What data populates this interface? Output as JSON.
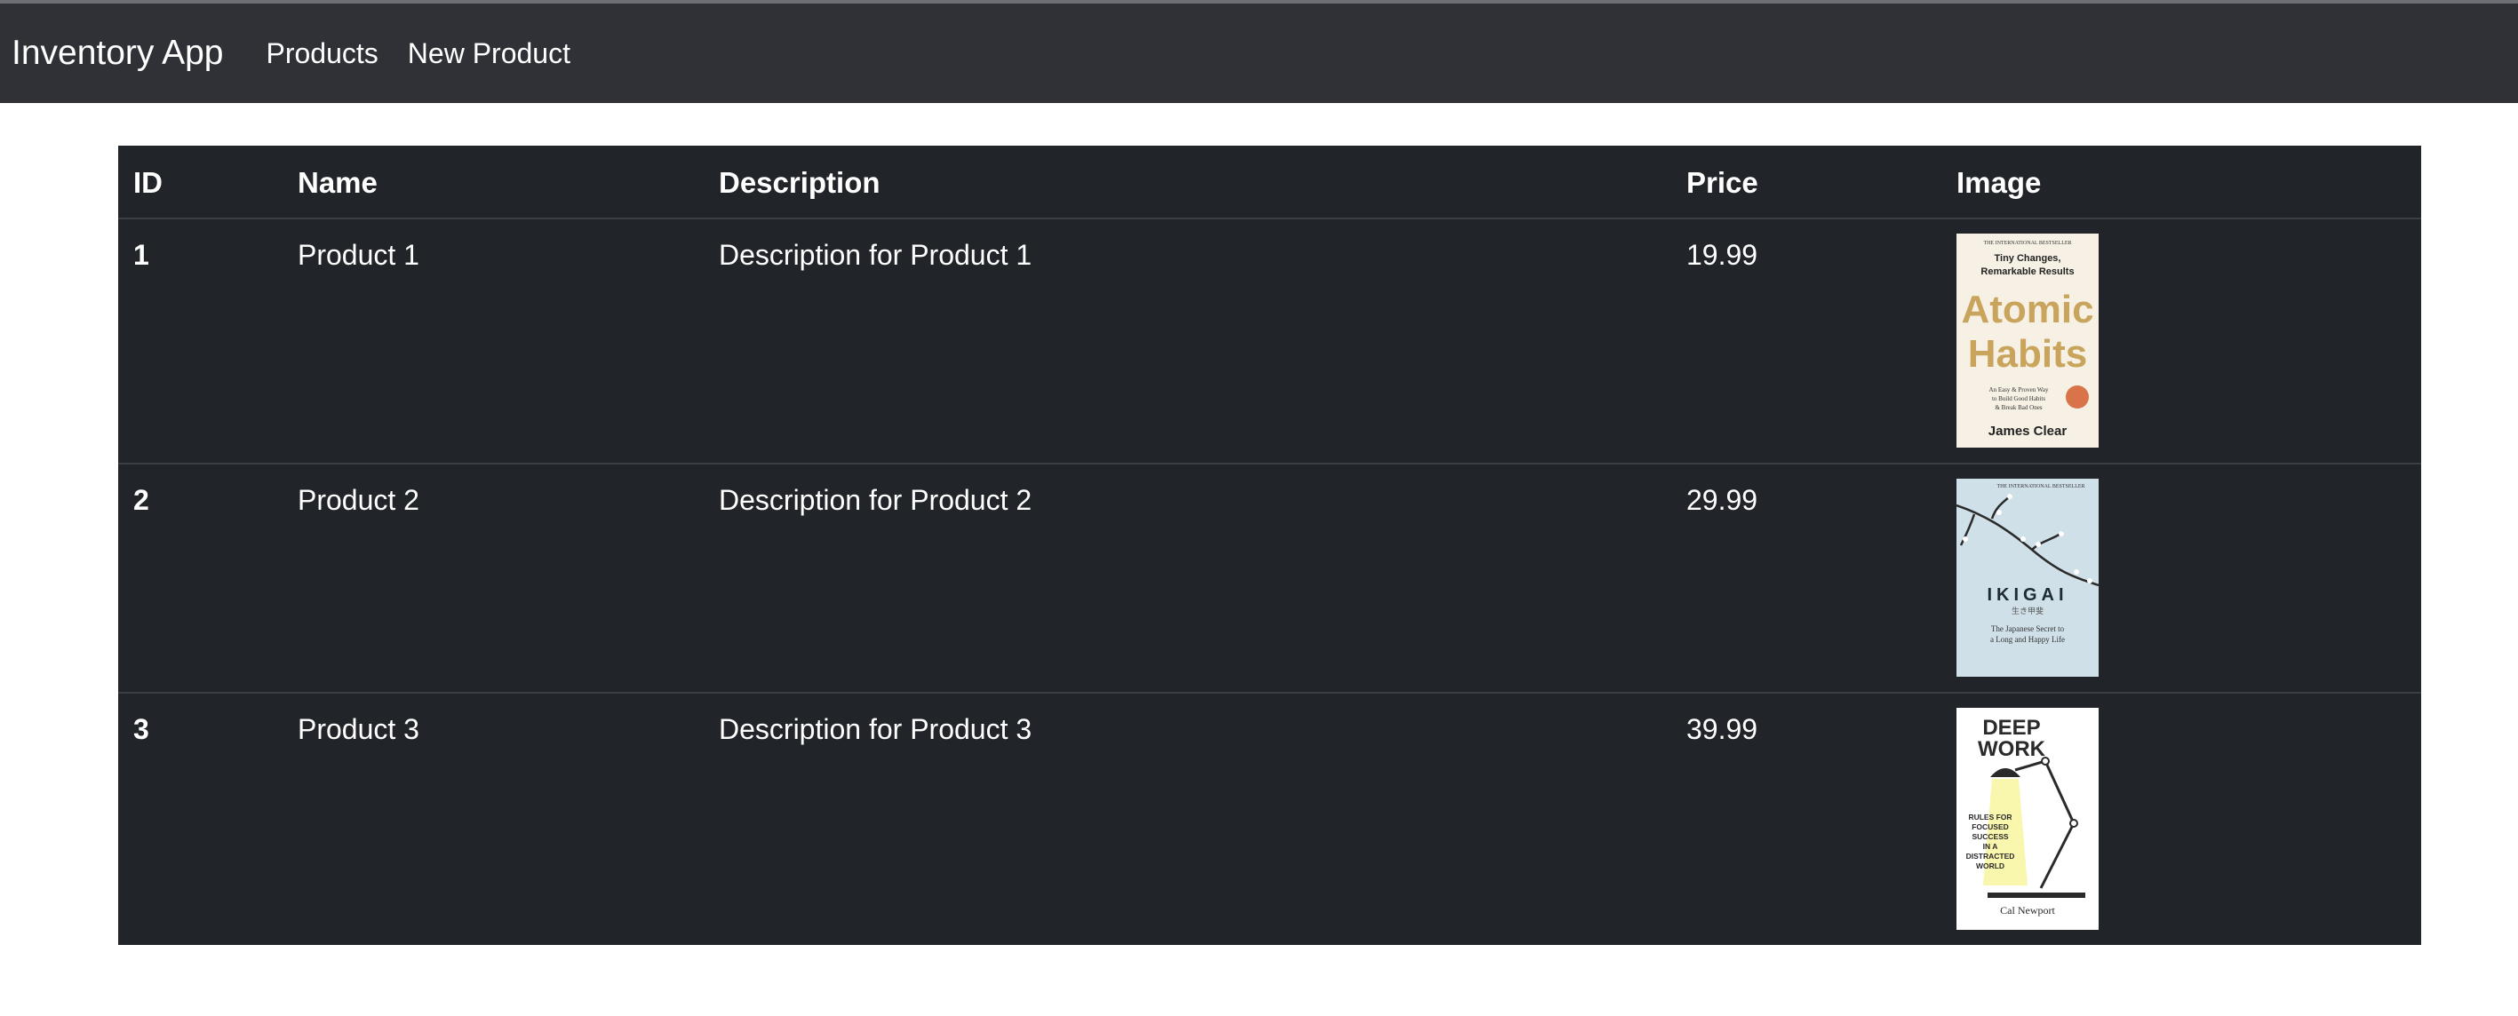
{
  "navbar": {
    "brand": "Inventory App",
    "links": [
      "Products",
      "New Product"
    ]
  },
  "table": {
    "columns": [
      "ID",
      "Name",
      "Description",
      "Price",
      "Image"
    ],
    "rows": [
      {
        "id": "1",
        "name": "Product 1",
        "description": "Description for Product 1",
        "price": "19.99"
      },
      {
        "id": "2",
        "name": "Product 2",
        "description": "Description for Product 2",
        "price": "29.99"
      },
      {
        "id": "3",
        "name": "Product 3",
        "description": "Description for Product 3",
        "price": "39.99"
      }
    ]
  },
  "images": {
    "atomic": {
      "tag": "THE INTERNATIONAL BESTSELLER",
      "sub1": "Tiny Changes,",
      "sub2": "Remarkable Results",
      "title1": "Atomic",
      "title2": "Habits",
      "blurb1": "An Easy & Proven Way",
      "blurb2": "to Build Good Habits",
      "blurb3": "& Break Bad Ones",
      "author": "James Clear"
    },
    "ikigai": {
      "tag": "THE INTERNATIONAL BESTSELLER",
      "title": "IKIGAI",
      "kanji": "生き甲斐",
      "sub1": "The Japanese Secret to",
      "sub2": "a Long and Happy Life"
    },
    "deepwork": {
      "title1": "DEEP",
      "title2": "WORK",
      "sub1": "RULES FOR",
      "sub2": "FOCUSED",
      "sub3": "SUCCESS",
      "sub4": "IN A",
      "sub5": "DISTRACTED",
      "sub6": "WORLD",
      "author": "Cal Newport"
    }
  },
  "colors": {
    "navbar_bg": "#2f3136",
    "table_bg": "#212529",
    "page_bg": "#ffffff"
  }
}
